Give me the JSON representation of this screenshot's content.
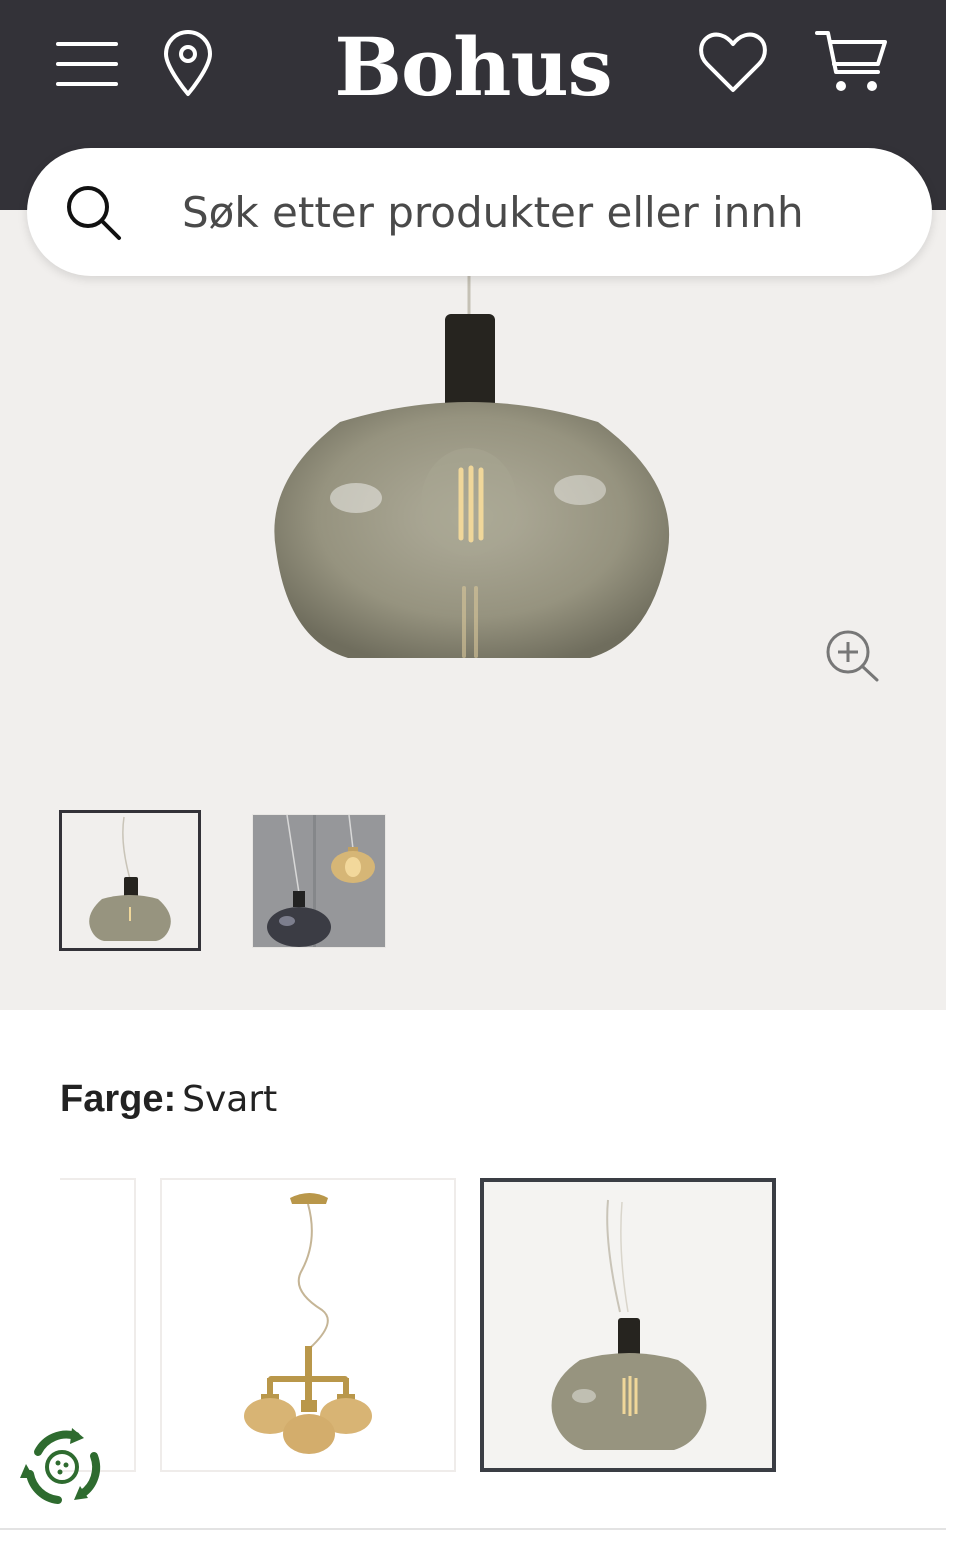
{
  "header": {
    "brand": "Bohus",
    "menu_icon": "hamburger-menu-icon",
    "store_icon": "location-pin-icon",
    "wishlist_icon": "heart-icon",
    "cart_icon": "shopping-cart-icon",
    "background_color": "#333238"
  },
  "search": {
    "placeholder": "Søk etter produkter eller innh",
    "icon": "search-icon"
  },
  "gallery": {
    "zoom_icon": "zoom-in-icon",
    "thumbnails": [
      {
        "alt": "Pendant lamp with smoked glass shade",
        "active": true
      },
      {
        "alt": "Pendant lamps hanging by concrete wall",
        "active": false
      }
    ]
  },
  "variant": {
    "label": "Farge:",
    "value": "Svart",
    "swatches": [
      {
        "alt": "Previous colour variant",
        "selected": false
      },
      {
        "alt": "Brass chandelier with amber glass shades",
        "selected": false
      },
      {
        "alt": "Black pendant with smoked glass shade",
        "selected": true
      }
    ]
  },
  "eco_badge": {
    "icon": "recycle-icon",
    "color": "#2e6b2f"
  },
  "colors": {
    "accent": "#333238",
    "gallery_bg": "#f1efed"
  }
}
